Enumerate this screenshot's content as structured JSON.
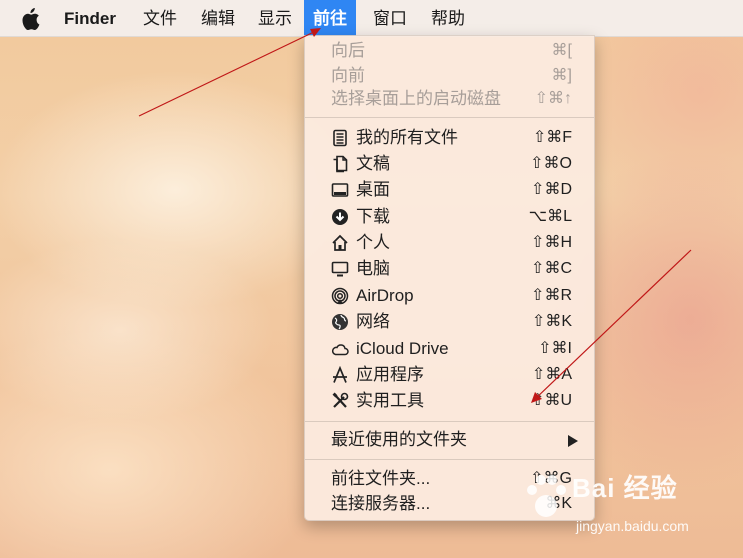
{
  "menubar": {
    "apple": "apple-icon",
    "items": [
      {
        "label": "Finder",
        "active": false
      },
      {
        "label": "文件",
        "active": false
      },
      {
        "label": "编辑",
        "active": false
      },
      {
        "label": "显示",
        "active": false
      },
      {
        "label": "前往",
        "active": true
      },
      {
        "label": "窗口",
        "active": false
      },
      {
        "label": "帮助",
        "active": false
      }
    ]
  },
  "menu": {
    "group1": [
      {
        "label": "向后",
        "shortcut": "⌘[",
        "enabled": false
      },
      {
        "label": "向前",
        "shortcut": "⌘]",
        "enabled": false
      },
      {
        "label": "选择桌面上的启动磁盘",
        "shortcut": "⇧⌘↑",
        "enabled": false
      }
    ],
    "group2": [
      {
        "label": "我的所有文件",
        "shortcut": "⇧⌘F",
        "icon": "all-files-icon"
      },
      {
        "label": "文稿",
        "shortcut": "⇧⌘O",
        "icon": "documents-icon"
      },
      {
        "label": "桌面",
        "shortcut": "⇧⌘D",
        "icon": "desktop-icon"
      },
      {
        "label": "下载",
        "shortcut": "⌥⌘L",
        "icon": "downloads-icon"
      },
      {
        "label": "个人",
        "shortcut": "⇧⌘H",
        "icon": "home-icon"
      },
      {
        "label": "电脑",
        "shortcut": "⇧⌘C",
        "icon": "computer-icon"
      },
      {
        "label": "AirDrop",
        "shortcut": "⇧⌘R",
        "icon": "airdrop-icon"
      },
      {
        "label": "网络",
        "shortcut": "⇧⌘K",
        "icon": "network-icon"
      },
      {
        "label": "iCloud Drive",
        "shortcut": "⇧⌘I",
        "icon": "icloud-icon"
      },
      {
        "label": "应用程序",
        "shortcut": "⇧⌘A",
        "icon": "applications-icon"
      },
      {
        "label": "实用工具",
        "shortcut": "⇧⌘U",
        "icon": "utilities-icon"
      }
    ],
    "recent_folders": {
      "label": "最近使用的文件夹",
      "icon": "submenu-arrow-icon"
    },
    "group4": [
      {
        "label": "前往文件夹...",
        "shortcut": "⇧⌘G"
      },
      {
        "label": "连接服务器...",
        "shortcut": "⌘K"
      }
    ]
  },
  "watermark": {
    "brand": "Bai 经验",
    "url": "jingyan.baidu.com"
  },
  "colors": {
    "menu_highlight": "#2f86f3",
    "annotation_arrow": "#c01818"
  }
}
